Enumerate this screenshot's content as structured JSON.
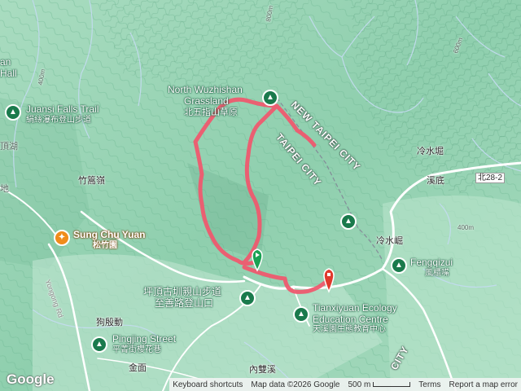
{
  "map": {
    "colors": {
      "terrain_light": "#b6e3cb",
      "terrain_mid": "#8fd1b0",
      "terrain_dark": "#5fa985",
      "stream": "#c7d9f2",
      "route": "#ef5a6f",
      "road": "#ffffff",
      "pin_green": "#1f7a4f",
      "pin_orange": "#f08c1b",
      "start_marker": "#1aa153",
      "end_marker": "#e03a2d"
    },
    "labels": {
      "north_wuzhishan_en1": "North Wuzhishan",
      "north_wuzhishan_en2": "Grassland",
      "north_wuzhishan_zh": "北五指山草原",
      "juansi_en": "Juansi Falls Trail",
      "juansi_zh": "絹絲瀑布登山步道",
      "left_edge_top": "an",
      "left_edge_hall": "Hall",
      "huhu": "頂湖",
      "zhugaoling": "竹篙嶺",
      "sung_chu_yuan_en": "Sung Chu Yuan",
      "sung_chu_yuan_zh": "松竹園",
      "yongong_rd": "Yongong Rd",
      "trailhead_zh1": "坪頂古圳親山步道",
      "trailhead_zh2": "至善路登山口",
      "gouyindong": "狗殷動",
      "pingjing_en": "Pingjing Street",
      "pingjing_zh": "平菁街櫻花巷",
      "jinmian": "金面",
      "neishuangxi": "內雙溪",
      "tianxiyuan_en1": "Tianxiyuan Ecology",
      "tianxiyuan_en2": "Education Centre",
      "tianxiyuan_zh": "天溪園生態教育中心",
      "new_taipei_city": "NEW TAIPEI CITY",
      "taipei_city": "TAIPEI CITY",
      "lengshuikeng": "冷水堀",
      "xidi": "溪底",
      "road_bei28_2": "北28-2",
      "lengshuiliao": "冷水崛",
      "fengqizui_en": "Fengqizui",
      "fengqizui_zh": "風櫃嘴",
      "elev_800": "800m",
      "elev_400a": "400m",
      "elev_400b": "400m",
      "elev_600": "600m",
      "left_edge_di": "地",
      "city_bottom": "CITY"
    },
    "footer": {
      "keyboard_shortcuts": "Keyboard shortcuts",
      "map_data": "Map data ©2026 Google",
      "scale": "500 m",
      "terms": "Terms",
      "report": "Report a map error"
    },
    "logo": "Google"
  }
}
